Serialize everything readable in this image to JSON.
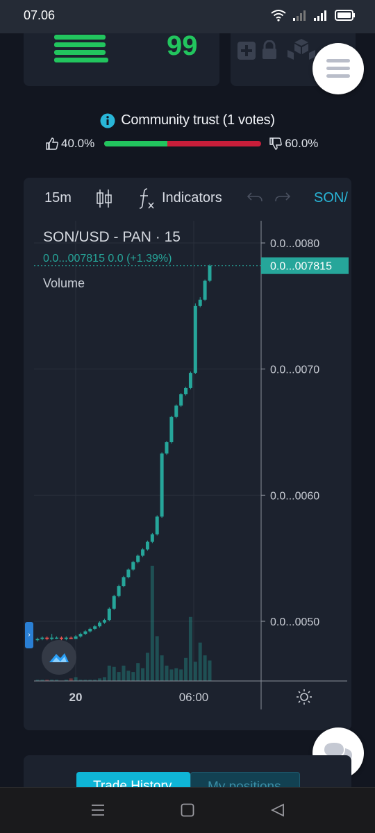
{
  "status_bar": {
    "time": "07.06",
    "icons": [
      "wifi-icon",
      "signal-icon",
      "signal-icon",
      "battery-icon"
    ]
  },
  "header": {
    "score": "99",
    "score_color": "#22c55e",
    "icons": [
      "plus-square-icon",
      "lock-icon",
      "blocks-icon",
      "menu-icon"
    ]
  },
  "trust": {
    "title": "Community trust (1 votes)",
    "up_percent": "40.0%",
    "down_percent": "60.0%",
    "up_fraction": 0.4,
    "up_color": "#22c55e",
    "down_color": "#c81e3a"
  },
  "chart_toolbar": {
    "timeframe": "15m",
    "indicators_label": "Indicators",
    "symbol": "SON/"
  },
  "chart_legend": {
    "title": "SON/USD - PAN · 15",
    "ohlc": "0.0...007815  0.0 (+1.39%)",
    "volume_label": "Volume"
  },
  "chart_data": {
    "type": "candlestick",
    "symbol": "SON/USD - PAN",
    "interval": "15",
    "x_ticks": [
      "20",
      "06:00"
    ],
    "y_ticks": [
      "0.0...0050",
      "0.0...0060",
      "0.0...0070",
      "0.0...0080"
    ],
    "last_price_label": "0.0...007815",
    "up_color": "#26a69a",
    "down_color": "#ef5350",
    "ylim": [
      0.0045,
      0.0082
    ],
    "candles": [
      {
        "o": 0.00485,
        "c": 0.00486,
        "h": 0.00487,
        "l": 0.00484
      },
      {
        "o": 0.00486,
        "c": 0.00487,
        "h": 0.00488,
        "l": 0.00485
      },
      {
        "o": 0.00487,
        "c": 0.00486,
        "h": 0.00488,
        "l": 0.00485
      },
      {
        "o": 0.00486,
        "c": 0.00487,
        "h": 0.0049,
        "l": 0.00485
      },
      {
        "o": 0.00487,
        "c": 0.00487,
        "h": 0.00488,
        "l": 0.00486
      },
      {
        "o": 0.00487,
        "c": 0.00486,
        "h": 0.00488,
        "l": 0.00485
      },
      {
        "o": 0.00486,
        "c": 0.00487,
        "h": 0.00488,
        "l": 0.00485
      },
      {
        "o": 0.00487,
        "c": 0.00486,
        "h": 0.00488,
        "l": 0.00486
      },
      {
        "o": 0.00486,
        "c": 0.00488,
        "h": 0.00489,
        "l": 0.00486
      },
      {
        "o": 0.00488,
        "c": 0.0049,
        "h": 0.00491,
        "l": 0.00487
      },
      {
        "o": 0.0049,
        "c": 0.00492,
        "h": 0.00493,
        "l": 0.00489
      },
      {
        "o": 0.00492,
        "c": 0.00494,
        "h": 0.00495,
        "l": 0.00491
      },
      {
        "o": 0.00494,
        "c": 0.00496,
        "h": 0.00497,
        "l": 0.00493
      },
      {
        "o": 0.00496,
        "c": 0.00499,
        "h": 0.005,
        "l": 0.00495
      },
      {
        "o": 0.00499,
        "c": 0.00501,
        "h": 0.00502,
        "l": 0.00498
      },
      {
        "o": 0.00501,
        "c": 0.0051,
        "h": 0.00511,
        "l": 0.005
      },
      {
        "o": 0.0051,
        "c": 0.0052,
        "h": 0.00521,
        "l": 0.00509
      },
      {
        "o": 0.0052,
        "c": 0.00528,
        "h": 0.00529,
        "l": 0.00519
      },
      {
        "o": 0.00528,
        "c": 0.00535,
        "h": 0.00536,
        "l": 0.00527
      },
      {
        "o": 0.00535,
        "c": 0.00541,
        "h": 0.00542,
        "l": 0.00534
      },
      {
        "o": 0.00541,
        "c": 0.00547,
        "h": 0.00548,
        "l": 0.0054
      },
      {
        "o": 0.00547,
        "c": 0.00552,
        "h": 0.00553,
        "l": 0.00546
      },
      {
        "o": 0.00552,
        "c": 0.00557,
        "h": 0.00558,
        "l": 0.00551
      },
      {
        "o": 0.00557,
        "c": 0.00563,
        "h": 0.00564,
        "l": 0.00556
      },
      {
        "o": 0.00563,
        "c": 0.00569,
        "h": 0.0057,
        "l": 0.00562
      },
      {
        "o": 0.00569,
        "c": 0.00583,
        "h": 0.00584,
        "l": 0.00568
      },
      {
        "o": 0.00583,
        "c": 0.00633,
        "h": 0.00634,
        "l": 0.00582
      },
      {
        "o": 0.00633,
        "c": 0.00642,
        "h": 0.00643,
        "l": 0.00632
      },
      {
        "o": 0.00642,
        "c": 0.00662,
        "h": 0.00663,
        "l": 0.00641
      },
      {
        "o": 0.00662,
        "c": 0.00671,
        "h": 0.00672,
        "l": 0.00661
      },
      {
        "o": 0.00671,
        "c": 0.0068,
        "h": 0.00681,
        "l": 0.0067
      },
      {
        "o": 0.0068,
        "c": 0.00685,
        "h": 0.00686,
        "l": 0.00679
      },
      {
        "o": 0.00685,
        "c": 0.00697,
        "h": 0.00698,
        "l": 0.00684
      },
      {
        "o": 0.00697,
        "c": 0.0075,
        "h": 0.00752,
        "l": 0.00696
      },
      {
        "o": 0.0075,
        "c": 0.00755,
        "h": 0.00757,
        "l": 0.00749
      },
      {
        "o": 0.00755,
        "c": 0.0077,
        "h": 0.00771,
        "l": 0.00754
      },
      {
        "o": 0.0077,
        "c": 0.00782,
        "h": 0.00783,
        "l": 0.00769
      }
    ],
    "volumes": [
      1,
      1,
      1,
      1,
      1,
      0,
      1,
      2,
      3,
      1,
      1,
      1,
      1,
      2,
      3,
      12,
      11,
      7,
      12,
      8,
      7,
      14,
      10,
      22,
      90,
      35,
      20,
      12,
      9,
      10,
      9,
      18,
      50,
      15,
      30,
      20,
      16
    ]
  },
  "chat_fab_icon": "chat-bubbles-icon",
  "bottom_tabs": {
    "trade_history": "Trade History",
    "my_positions": "My positions"
  },
  "nav_bar": {
    "icons": [
      "menu-icon",
      "home-icon",
      "back-icon"
    ]
  }
}
